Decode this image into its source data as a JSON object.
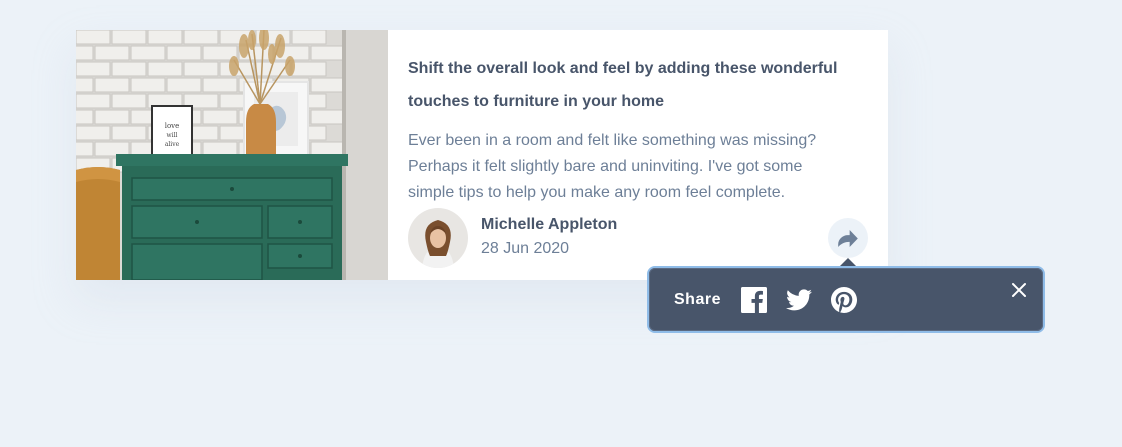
{
  "article": {
    "title": "Shift the overall look and feel by adding these wonderful touches to furniture in your home",
    "description": "Ever been in a room and felt like something was missing? Perhaps it felt slightly bare and uninviting. I've got some simple tips to help you make any room feel complete.",
    "author": {
      "name": "Michelle Appleton",
      "date": "28 Jun 2020"
    }
  },
  "share": {
    "label": "Share",
    "networks": [
      "facebook-icon",
      "twitter-icon",
      "pinterest-icon"
    ]
  },
  "colors": {
    "background": "#ecf2f8",
    "popup": "#48556a",
    "popup_border": "#8fbce8",
    "dresser": "#2d6b5a",
    "text_heading": "#48556a",
    "text_body": "#6d7f97"
  }
}
